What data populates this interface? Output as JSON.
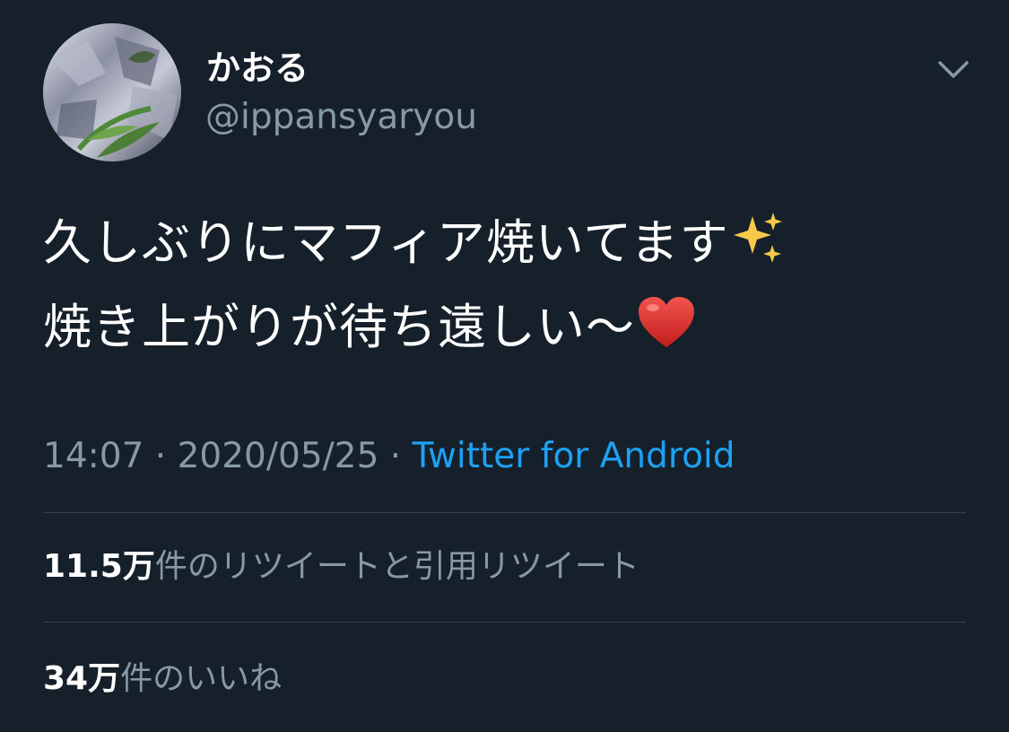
{
  "user": {
    "display_name": "かおる",
    "handle": "@ippansyaryou",
    "avatar_icon": "profile-photo"
  },
  "tweet": {
    "line1": "久しぶりにマフィア焼いてます",
    "line1_emoji": "sparkles-emoji",
    "line2": "焼き上がりが待ち遠しい〜",
    "line2_emoji": "red-heart-emoji"
  },
  "meta": {
    "time": "14:07",
    "separator1": " · ",
    "date": "2020/05/25",
    "separator2": " · ",
    "source": "Twitter for Android"
  },
  "stats": {
    "retweets_count": "11.5万",
    "retweets_label": "件のリツイートと引用リツイート",
    "likes_count": "34万",
    "likes_label": "件のいいね"
  },
  "icons": {
    "more": "chevron-down-icon"
  },
  "colors": {
    "background": "#15202b",
    "text_primary": "#ffffff",
    "text_secondary": "#8899a6",
    "link": "#1da1f2",
    "divider": "#38444d"
  }
}
